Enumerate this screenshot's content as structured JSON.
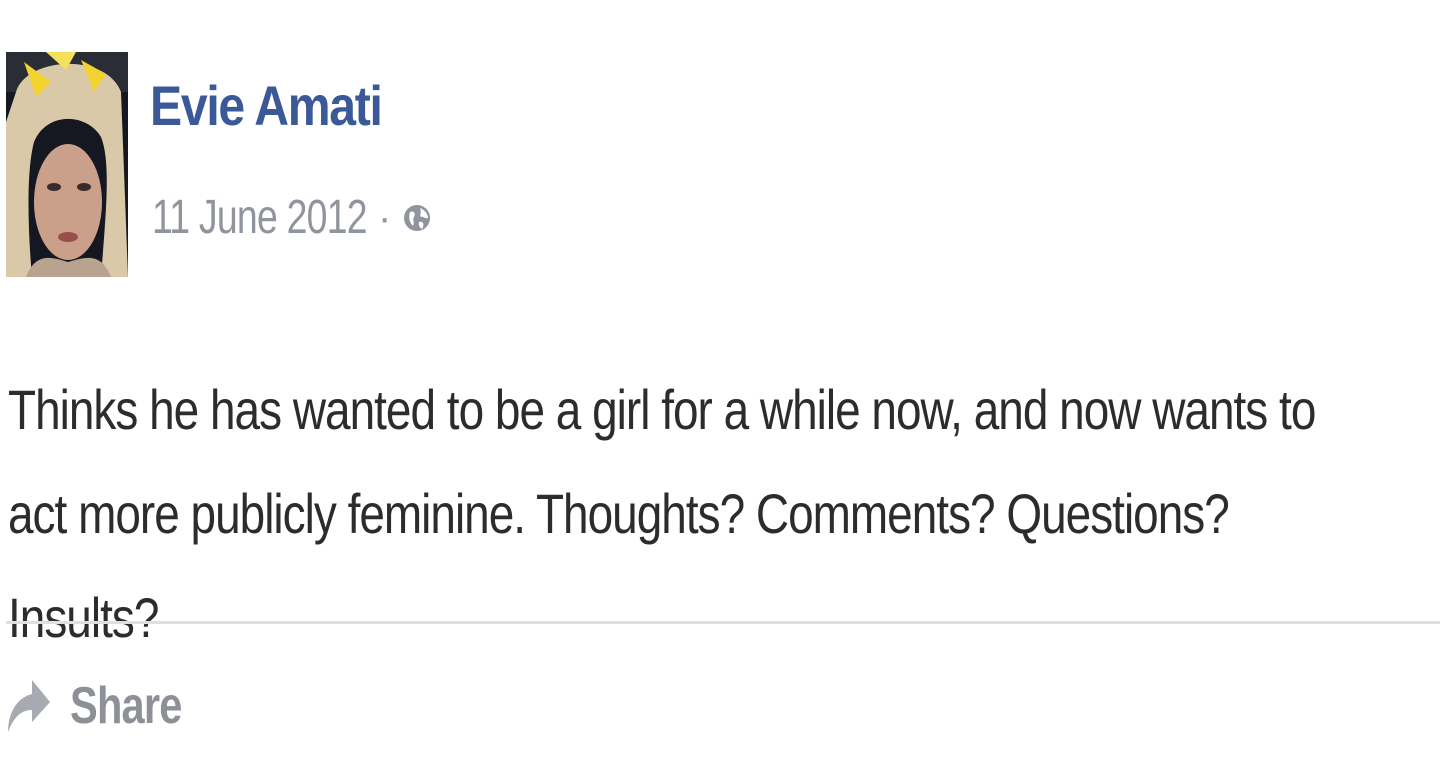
{
  "post": {
    "author": "Evie Amati",
    "date": "11 June 2012",
    "separator": "·",
    "audience_icon": "globe-icon",
    "text": "Thinks he has wanted to be a girl for a while now, and now wants to act more publicly feminine. Thoughts? Comments? Questions? Insults?"
  },
  "actions": {
    "share_label": "Share",
    "share_icon": "share-arrow-icon"
  },
  "colors": {
    "author_name": "#3b5998",
    "meta_text": "#90949c",
    "body_text": "#2c2c2c",
    "divider": "#dddfe2"
  }
}
